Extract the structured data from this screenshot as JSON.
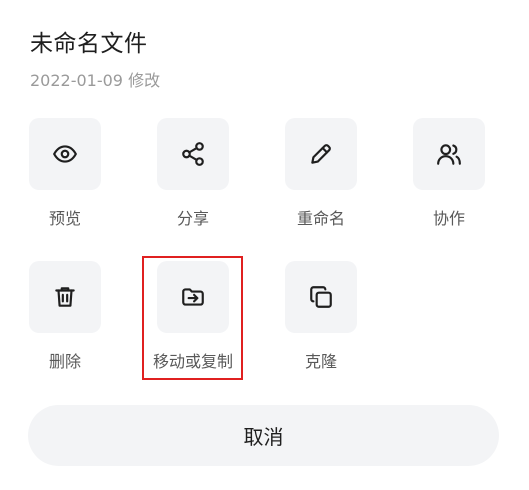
{
  "file": {
    "title": "未命名文件",
    "modified": "2022-01-09 修改"
  },
  "actions": [
    {
      "label": "预览",
      "icon": "eye-icon"
    },
    {
      "label": "分享",
      "icon": "share-icon"
    },
    {
      "label": "重命名",
      "icon": "pencil-icon"
    },
    {
      "label": "协作",
      "icon": "users-icon"
    },
    {
      "label": "删除",
      "icon": "trash-icon"
    },
    {
      "label": "移动或复制",
      "icon": "folder-move-icon"
    },
    {
      "label": "克隆",
      "icon": "copy-icon"
    }
  ],
  "cancel_label": "取消",
  "colors": {
    "tile_bg": "#f3f4f6",
    "highlight": "#e02020",
    "label": "#595959",
    "meta": "#9a9a9a"
  }
}
